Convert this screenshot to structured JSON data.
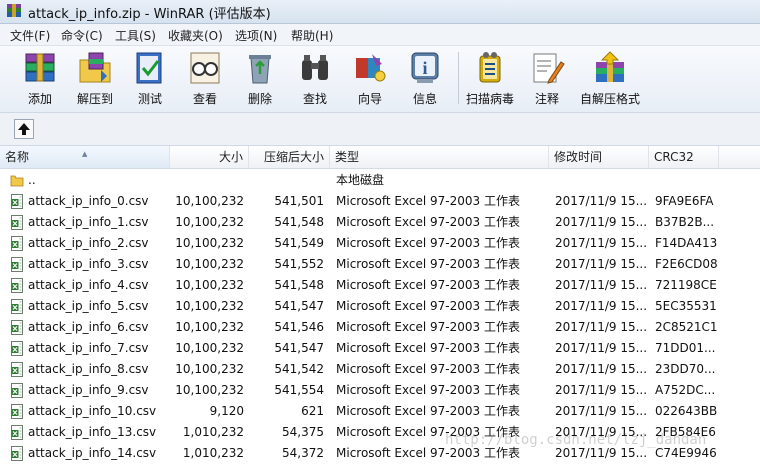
{
  "window": {
    "title": "attack_ip_info.zip - WinRAR (评估版本)"
  },
  "menu": [
    "文件(F)",
    "命令(C)",
    "工具(S)",
    "收藏夹(O)",
    "选项(N)",
    "帮助(H)"
  ],
  "toolbar": [
    {
      "label": "添加",
      "icon": "add-books-icon"
    },
    {
      "label": "解压到",
      "icon": "extract-folder-icon"
    },
    {
      "label": "测试",
      "icon": "test-check-icon"
    },
    {
      "label": "查看",
      "icon": "view-glasses-icon"
    },
    {
      "label": "删除",
      "icon": "delete-recycle-icon"
    },
    {
      "label": "查找",
      "icon": "find-binoculars-icon"
    },
    {
      "label": "向导",
      "icon": "wizard-icon"
    },
    {
      "label": "信息",
      "icon": "info-icon"
    },
    {
      "label": "扫描病毒",
      "icon": "virus-scan-icon"
    },
    {
      "label": "注释",
      "icon": "comment-pen-icon"
    },
    {
      "label": "自解压格式",
      "icon": "sfx-box-icon"
    }
  ],
  "columns": {
    "name": "名称",
    "size": "大小",
    "packed": "压缩后大小",
    "type": "类型",
    "modified": "修改时间",
    "crc": "CRC32"
  },
  "parent_row": {
    "name": "..",
    "type": "本地磁盘"
  },
  "files": [
    {
      "name": "attack_ip_info_0.csv",
      "size": "10,100,232",
      "packed": "541,501",
      "type": "Microsoft Excel 97-2003 工作表",
      "modified": "2017/11/9 15...",
      "crc": "9FA9E6FA"
    },
    {
      "name": "attack_ip_info_1.csv",
      "size": "10,100,232",
      "packed": "541,548",
      "type": "Microsoft Excel 97-2003 工作表",
      "modified": "2017/11/9 15...",
      "crc": "B37B2B..."
    },
    {
      "name": "attack_ip_info_2.csv",
      "size": "10,100,232",
      "packed": "541,549",
      "type": "Microsoft Excel 97-2003 工作表",
      "modified": "2017/11/9 15...",
      "crc": "F14DA413"
    },
    {
      "name": "attack_ip_info_3.csv",
      "size": "10,100,232",
      "packed": "541,552",
      "type": "Microsoft Excel 97-2003 工作表",
      "modified": "2017/11/9 15...",
      "crc": "F2E6CD08"
    },
    {
      "name": "attack_ip_info_4.csv",
      "size": "10,100,232",
      "packed": "541,548",
      "type": "Microsoft Excel 97-2003 工作表",
      "modified": "2017/11/9 15...",
      "crc": "721198CE"
    },
    {
      "name": "attack_ip_info_5.csv",
      "size": "10,100,232",
      "packed": "541,547",
      "type": "Microsoft Excel 97-2003 工作表",
      "modified": "2017/11/9 15...",
      "crc": "5EC35531"
    },
    {
      "name": "attack_ip_info_6.csv",
      "size": "10,100,232",
      "packed": "541,546",
      "type": "Microsoft Excel 97-2003 工作表",
      "modified": "2017/11/9 15...",
      "crc": "2C8521C1"
    },
    {
      "name": "attack_ip_info_7.csv",
      "size": "10,100,232",
      "packed": "541,547",
      "type": "Microsoft Excel 97-2003 工作表",
      "modified": "2017/11/9 15...",
      "crc": "71DD01..."
    },
    {
      "name": "attack_ip_info_8.csv",
      "size": "10,100,232",
      "packed": "541,542",
      "type": "Microsoft Excel 97-2003 工作表",
      "modified": "2017/11/9 15...",
      "crc": "23DD70..."
    },
    {
      "name": "attack_ip_info_9.csv",
      "size": "10,100,232",
      "packed": "541,554",
      "type": "Microsoft Excel 97-2003 工作表",
      "modified": "2017/11/9 15...",
      "crc": "A752DC..."
    },
    {
      "name": "attack_ip_info_10.csv",
      "size": "9,120",
      "packed": "621",
      "type": "Microsoft Excel 97-2003 工作表",
      "modified": "2017/11/9 15...",
      "crc": "022643BB"
    },
    {
      "name": "attack_ip_info_13.csv",
      "size": "1,010,232",
      "packed": "54,375",
      "type": "Microsoft Excel 97-2003 工作表",
      "modified": "2017/11/9 15...",
      "crc": "2FB584E6"
    },
    {
      "name": "attack_ip_info_14.csv",
      "size": "1,010,232",
      "packed": "54,372",
      "type": "Microsoft Excel 97-2003 工作表",
      "modified": "2017/11/9 15...",
      "crc": "C74E9946"
    }
  ],
  "watermark": "http://blog.csdn.net/lzj_dandan"
}
